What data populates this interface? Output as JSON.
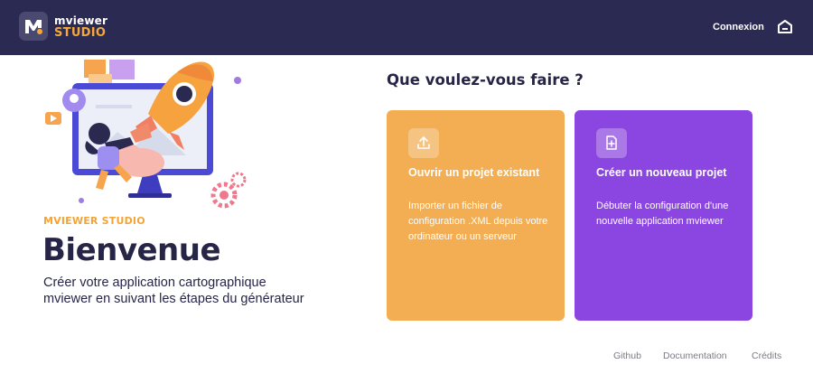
{
  "header": {
    "brand_top": "mviewer",
    "brand_bottom": "STUDIO",
    "login_label": "Connexion",
    "logo_icon": "mviewer-logo-icon",
    "home_icon": "home-icon"
  },
  "hero": {
    "tagline": "MVIEWER STUDIO",
    "title": "Bienvenue",
    "subtitle": "Créer votre application cartographique mviewer en suivant les étapes du générateur",
    "illustration": "rocket-launch-illustration"
  },
  "main": {
    "question": "Que voulez-vous faire ?",
    "cards": [
      {
        "title": "Ouvrir un projet existant",
        "description": "Importer un fichier de configuration .XML depuis votre ordinateur ou un serveur",
        "icon": "upload-icon",
        "color": "#f3ad53"
      },
      {
        "title": "Créer un nouveau projet",
        "description": "Débuter la configuration d'une nouvelle application mviewer",
        "icon": "new-file-icon",
        "color": "#8b45e0"
      }
    ]
  },
  "footer": {
    "links": [
      "Github",
      "Documentation",
      "Crédits"
    ]
  },
  "colors": {
    "header_bg": "#2b2a52",
    "accent_orange": "#f4a436",
    "accent_purple": "#8b45e0",
    "text_dark": "#262547"
  }
}
